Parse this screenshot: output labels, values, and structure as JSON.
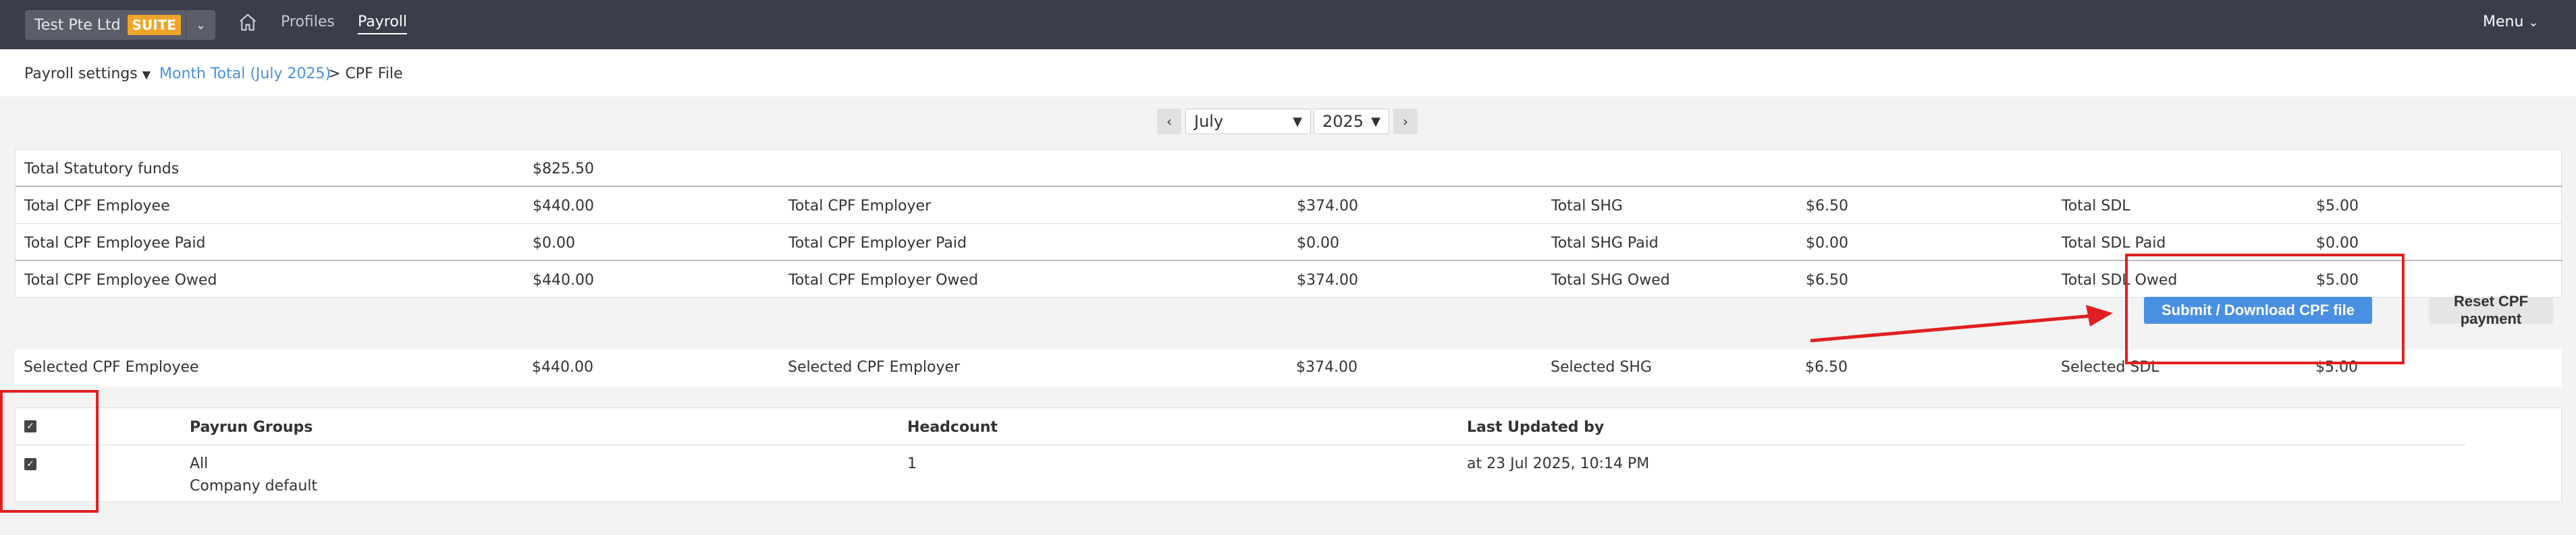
{
  "topbar": {
    "company_name": "Test Pte Ltd",
    "suite_badge": "SUITE",
    "nav": [
      "Profiles",
      "Payroll"
    ],
    "active": "Payroll",
    "menu_label": "Menu"
  },
  "breadcrumb": {
    "settings": "Payroll settings",
    "link": "Month Total (July 2025)",
    "separator": ">",
    "current": "CPF File"
  },
  "selector": {
    "month": "July",
    "year": "2025"
  },
  "totals": {
    "statutory_label": "Total Statutory funds",
    "statutory_value": "$825.50",
    "rows": [
      [
        "Total CPF Employee",
        "$440.00",
        "Total CPF Employer",
        "$374.00",
        "Total SHG",
        "$6.50",
        "Total SDL",
        "$5.00"
      ],
      [
        "Total CPF Employee Paid",
        "$0.00",
        "Total CPF Employer Paid",
        "$0.00",
        "Total SHG Paid",
        "$0.00",
        "Total SDL Paid",
        "$0.00"
      ],
      [
        "Total CPF Employee Owed",
        "$440.00",
        "Total CPF Employer Owed",
        "$374.00",
        "Total SHG Owed",
        "$6.50",
        "Total SDL Owed",
        "$5.00"
      ]
    ]
  },
  "actions": {
    "submit": "Submit / Download CPF file",
    "reset": "Reset CPF payment"
  },
  "selected": [
    "Selected CPF Employee",
    "$440.00",
    "Selected CPF Employer",
    "$374.00",
    "Selected SHG",
    "$6.50",
    "Selected SDL",
    "$5.00"
  ],
  "groups": {
    "headers": [
      "Payrun Groups",
      "Headcount",
      "Last Updated by"
    ],
    "rows": [
      {
        "name": "All",
        "note": "Company default",
        "headcount": "1",
        "updated": "at 23 Jul 2025, 10:14 PM"
      }
    ]
  },
  "colors": {
    "nav_bg": "#3b3d4a",
    "accent": "#4a90e2",
    "badge": "#f0a52a",
    "annotation": "#e02020"
  }
}
